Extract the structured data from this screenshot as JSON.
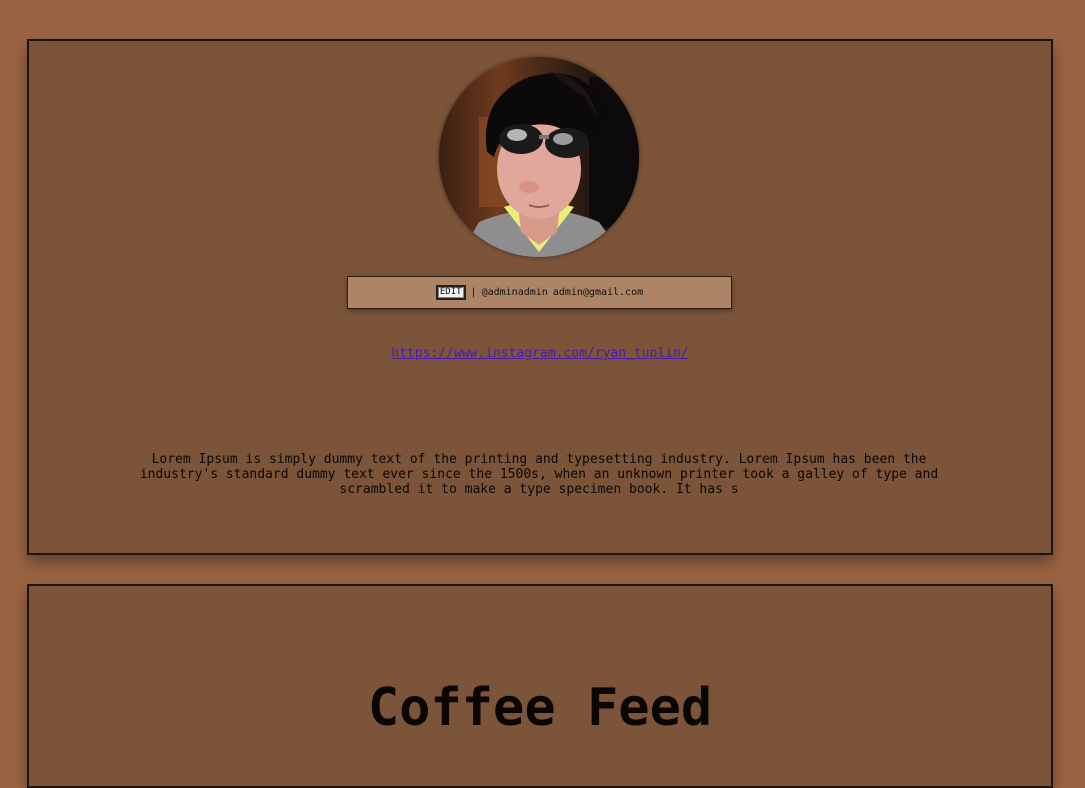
{
  "profile": {
    "avatar_alt": "profile photo",
    "edit_label": "EDIT",
    "separator": "|",
    "handle": "@adminadmin",
    "email": "admin@gmail.com",
    "link": "https://www.instagram.com/ryan_tuplin/",
    "bio": "Lorem Ipsum is simply dummy text of the printing and typesetting industry. Lorem Ipsum has been the industry's standard dummy text ever since the 1500s, when an unknown printer took a galley of type and scrambled it to make a type specimen book. It has s"
  },
  "feed": {
    "title": "Coffee Feed"
  },
  "colors": {
    "page_background": "#9a6442",
    "card_background": "#7b5439",
    "info_bar": "#ad8566",
    "link": "#4b1ea8"
  }
}
